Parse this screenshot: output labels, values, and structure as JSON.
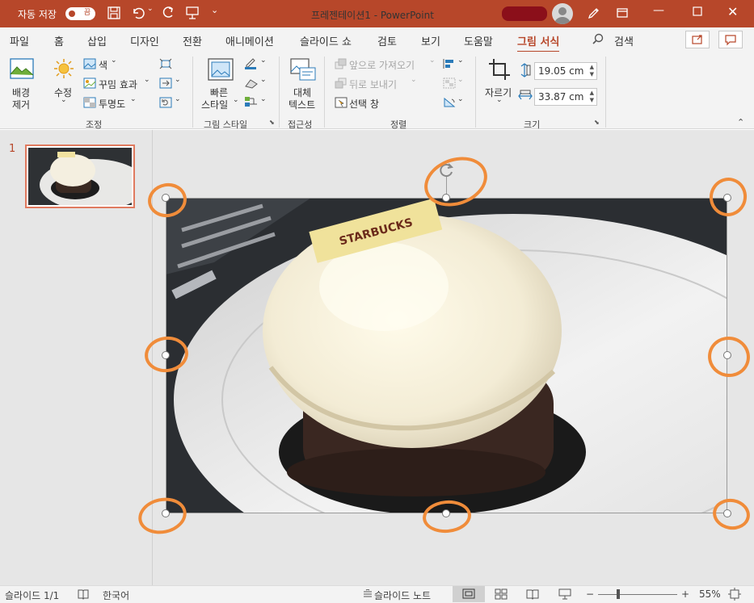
{
  "titlebar": {
    "autosave_label": "자동 저장",
    "autosave_state": "끔",
    "doc_title": "프레젠테이션1  -  PowerPoint",
    "brand_color": "#b7472a"
  },
  "tabs": [
    "파일",
    "홈",
    "삽입",
    "디자인",
    "전환",
    "애니메이션",
    "슬라이드 쇼",
    "검토",
    "보기",
    "도움말",
    "그림 서식"
  ],
  "active_tab": "그림 서식",
  "search_label": "검색",
  "ribbon": {
    "remove_bg": [
      "배경",
      "제거"
    ],
    "corrections": "수정",
    "color": "색",
    "artistic": "꾸밈 효과",
    "transparency": "투명도",
    "adjust_group": "조정",
    "quick_styles": [
      "빠른",
      "스타일"
    ],
    "styles_group": "그림 스타일",
    "alt_text": [
      "대체",
      "텍스트"
    ],
    "access_group": "접근성",
    "bring_forward": "앞으로 가져오기",
    "send_backward": "뒤로 보내기",
    "selection_pane": "선택 창",
    "arrange_group": "정렬",
    "crop": "자르기",
    "height": "19.05 cm",
    "width": "33.87 cm",
    "size_group": "크기"
  },
  "thumbnails": {
    "slide_number": "1"
  },
  "photo": {
    "brand_text": "STARBUCKS"
  },
  "status": {
    "slide_info": "슬라이드 1/1",
    "language": "한국어",
    "notes": "슬라이드 노트",
    "zoom_minus": "−",
    "zoom_plus": "+",
    "zoom": "55%"
  }
}
